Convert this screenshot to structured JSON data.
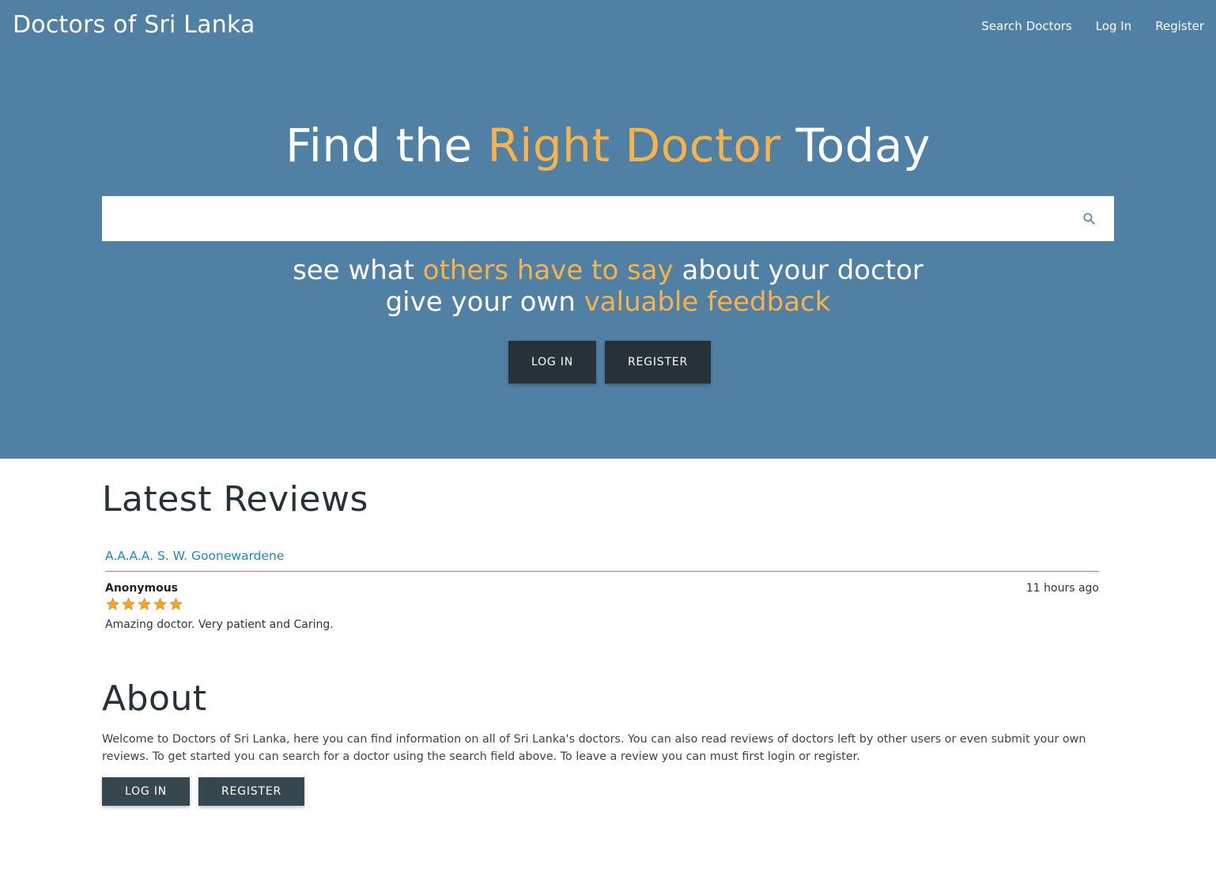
{
  "nav": {
    "title": "Doctors of Sri Lanka",
    "links": [
      "Search Doctors",
      "Log In",
      "Register"
    ]
  },
  "hero": {
    "headline_part1": "Find the ",
    "headline_accent": "Right Doctor",
    "headline_part2": " Today",
    "search_placeholder": "",
    "tagline_line1_part1": "see what ",
    "tagline_line1_accent": "others have to say",
    "tagline_line1_part2": " about your doctor",
    "tagline_line2_part1": "give your own ",
    "tagline_line2_accent": "valuable feedback",
    "login_label": "LOG IN",
    "register_label": "REGISTER"
  },
  "reviews": {
    "title": "Latest Reviews",
    "items": [
      {
        "doctor": "A.A.A.A. S. W. Goonewardene",
        "author": "Anonymous",
        "time": "11 hours ago",
        "rating": 5,
        "text": "Amazing doctor. Very patient and Caring."
      }
    ]
  },
  "about": {
    "title": "About",
    "text": "Welcome to Doctors of Sri Lanka, here you can find information on all of Sri Lanka's doctors. You can also read reviews of doctors left by other users or even submit your own reviews. To get started you can search for a doctor using the search field above. To leave a review you can must first login or register.",
    "login_label": "LOG IN",
    "register_label": "REGISTER"
  },
  "colors": {
    "hero_bg": "#5180a5",
    "accent": "#f7b24a",
    "button_bg": "#263238",
    "link": "#1e88c9",
    "star": "#f5a623"
  },
  "icons": {
    "search": "search-icon",
    "star": "star-icon"
  }
}
